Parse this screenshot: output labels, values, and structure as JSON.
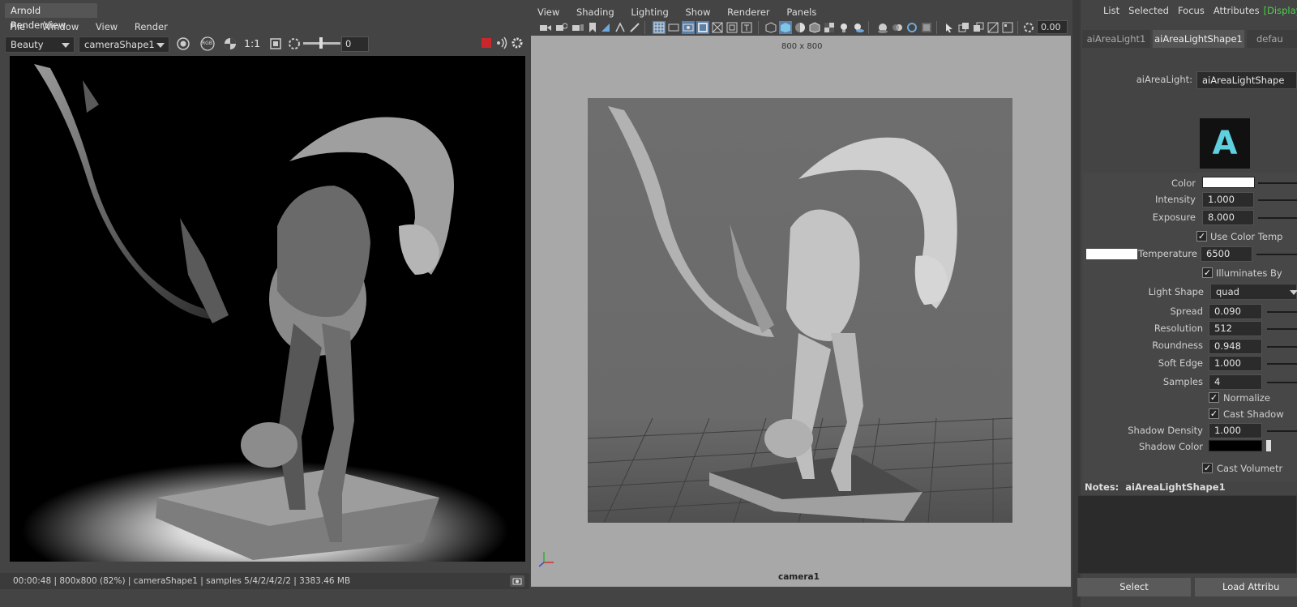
{
  "renderview": {
    "title": "Arnold RenderView",
    "menu": [
      "File",
      "Window",
      "View",
      "Render"
    ],
    "aov_select": "Beauty",
    "camera_select": "cameraShape1",
    "rgb_label": "RGB",
    "ratio_label": "1:1",
    "exposure_value": "0",
    "status": "00:00:48 | 800x800 (82%) | cameraShape1 | samples 5/4/2/4/2/2 | 3383.46 MB"
  },
  "viewport": {
    "menu": [
      "View",
      "Shading",
      "Lighting",
      "Show",
      "Renderer",
      "Panels"
    ],
    "zoom_value": "0.00",
    "resolution_label": "800 x 800",
    "camera_label": "camera1"
  },
  "attribute_editor": {
    "menu": [
      "List",
      "Selected",
      "Focus",
      "Attributes"
    ],
    "display_menu": "[Display]",
    "tabs": [
      "aiAreaLight1",
      "aiAreaLightShape1",
      "defau"
    ],
    "node_type_label": "aiAreaLight:",
    "node_name": "aiAreaLightShape",
    "logo_letter": "A",
    "attrs": {
      "color_label": "Color",
      "intensity_label": "Intensity",
      "intensity": "1.000",
      "exposure_label": "Exposure",
      "exposure": "8.000",
      "use_color_temp_label": "Use Color Temp",
      "temperature_label": "Temperature",
      "temperature": "6500",
      "illuminates_label": "Illuminates By",
      "light_shape_label": "Light Shape",
      "light_shape": "quad",
      "spread_label": "Spread",
      "spread": "0.090",
      "resolution_label": "Resolution",
      "resolution": "512",
      "roundness_label": "Roundness",
      "roundness": "0.948",
      "soft_edge_label": "Soft Edge",
      "soft_edge": "1.000",
      "samples_label": "Samples",
      "samples": "4",
      "normalize_label": "Normalize",
      "cast_shadows_label": "Cast Shadow",
      "shadow_density_label": "Shadow Density",
      "shadow_density": "1.000",
      "shadow_color_label": "Shadow Color",
      "cast_volumetric_label": "Cast Volumetr"
    },
    "notes_label": "Notes:",
    "notes_node": "aiAreaLightShape1",
    "select_button": "Select",
    "load_button": "Load Attribu"
  },
  "colors": {
    "accent_green": "#4cd24c",
    "stop_red": "#c8282c",
    "logo_cyan": "#5fd0e0"
  }
}
